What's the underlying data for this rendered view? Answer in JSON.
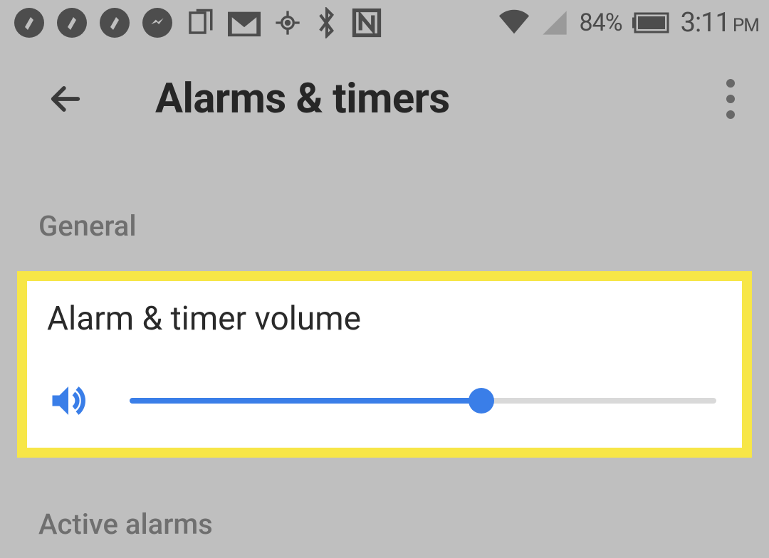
{
  "status": {
    "battery_pct": "84%",
    "time": "3:11",
    "ampm": "PM"
  },
  "appbar": {
    "title": "Alarms & timers"
  },
  "sections": {
    "general_label": "General",
    "active_alarms_label": "Active alarms"
  },
  "volume_card": {
    "title": "Alarm & timer volume",
    "slider_pct": 60
  },
  "colors": {
    "accent": "#3a7ee8",
    "highlight": "#f7e647"
  }
}
